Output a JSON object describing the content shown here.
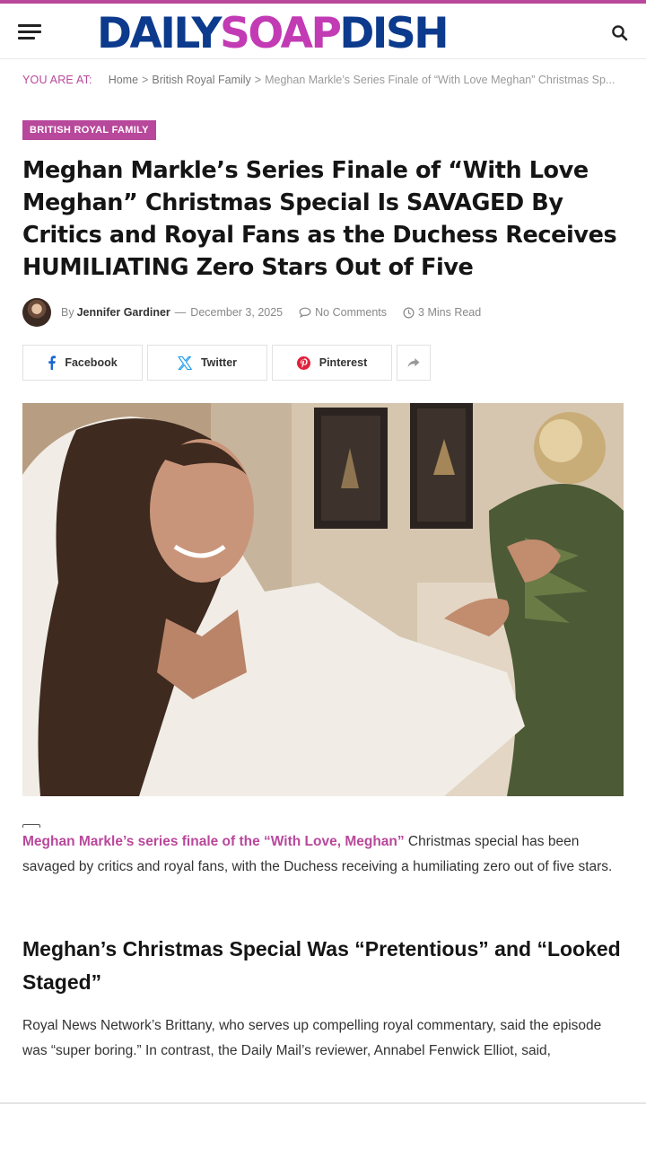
{
  "colors": {
    "accent": "#b8489b",
    "logo_blue": "#0c3a8c",
    "logo_pink": "#c23bb4"
  },
  "header": {
    "menu_icon": "hamburger-menu-icon",
    "logo": {
      "part1": "DAILY",
      "part2": "SOAP",
      "part3": "DISH"
    },
    "search_icon": "search-icon"
  },
  "breadcrumb": {
    "label": "YOU ARE AT:",
    "home": "Home",
    "separator": ">",
    "category": "British Royal Family",
    "current": "Meghan Markle’s Series Finale of “With Love Meghan” Christmas Sp..."
  },
  "article": {
    "category": "BRITISH ROYAL FAMILY",
    "title": "Meghan Markle’s Series Finale of “With Love Meghan” Christmas Special Is SAVAGED By Critics and Royal Fans as the Duchess Receives HUMILIATING Zero Stars Out of Five",
    "meta": {
      "by": "By",
      "author": "Jennifer Gardiner",
      "dash": "—",
      "date": "December 3, 2025",
      "comments": "No Comments",
      "read_time": "3 Mins Read"
    },
    "share": {
      "facebook": "Facebook",
      "twitter": "Twitter",
      "pinterest": "Pinterest",
      "more_icon": "share-arrow-icon"
    },
    "intro_lead": "Meghan Markle’s series finale of the “With Love, Meghan”",
    "intro_rest": " Christmas special has been savaged by critics and royal fans, with the Duchess receiving a humiliating zero out of five stars.",
    "subheading": "Meghan’s Christmas Special Was “Pretentious” and “Looked Staged”",
    "paragraph": "Royal News Network’s Brittany, who serves up compelling royal commentary, said the episode was “super boring.” In contrast, the Daily Mail’s reviewer, Annabel Fenwick Elliot, said,"
  }
}
